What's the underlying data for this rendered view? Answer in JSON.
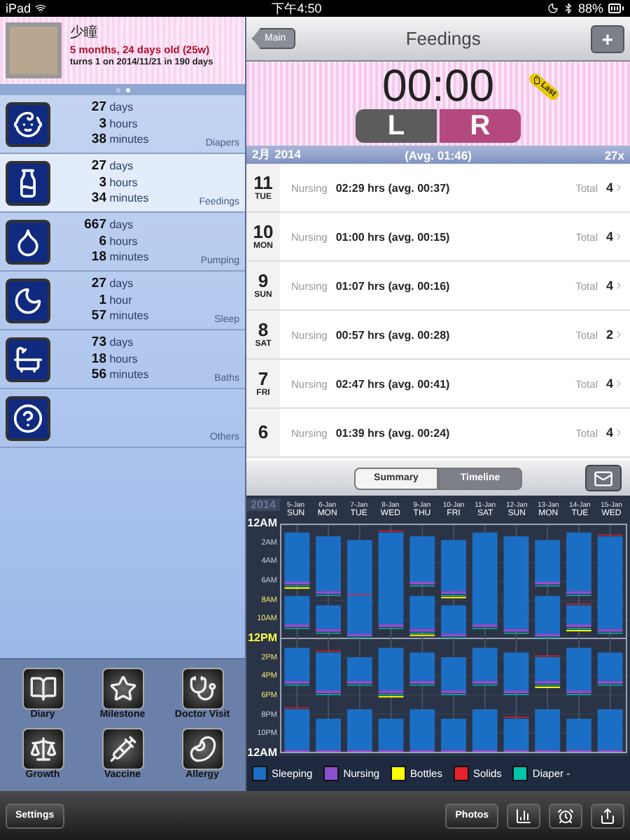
{
  "status_bar": {
    "device": "iPad",
    "time": "下午4:50",
    "battery": "88%"
  },
  "profile": {
    "name": "少瞳",
    "age": "5 months, 24 days old (25w)",
    "birthday": "turns 1 on 2014/11/21 in 190 days"
  },
  "page_dots": [
    {
      "selected": false
    },
    {
      "selected": true
    }
  ],
  "categories": [
    {
      "kind": "diapers",
      "lines": [
        "**27** days",
        "**3** hours",
        "**38** minutes"
      ],
      "label": "Diapers",
      "selected": false
    },
    {
      "kind": "feedings",
      "lines": [
        "**27** days",
        "**3** hours",
        "**34** minutes"
      ],
      "label": "Feedings",
      "selected": true
    },
    {
      "kind": "pumping",
      "lines": [
        "**667** days",
        "**6** hours",
        "**18** minutes"
      ],
      "label": "Pumping",
      "selected": false
    },
    {
      "kind": "sleep",
      "lines": [
        "**27** days",
        "**1** hour",
        "**57** minutes"
      ],
      "label": "Sleep",
      "selected": false
    },
    {
      "kind": "baths",
      "lines": [
        "**73** days",
        "**18** hours",
        "**56** minutes"
      ],
      "label": "Baths",
      "selected": false
    },
    {
      "kind": "others",
      "label": "Others",
      "selected": false
    }
  ],
  "shortcuts": [
    {
      "kind": "diary",
      "label": "Diary"
    },
    {
      "kind": "milestone",
      "label": "Milestone"
    },
    {
      "kind": "doctor",
      "label": "Doctor Visit"
    },
    {
      "kind": "growth",
      "label": "Growth"
    },
    {
      "kind": "vaccine",
      "label": "Vaccine"
    },
    {
      "kind": "allergy",
      "label": "Allergy"
    }
  ],
  "nav": {
    "back": "Main",
    "title": "Feedings",
    "add": "+"
  },
  "timer": {
    "time": "00:00",
    "sides": [
      {
        "label": "L",
        "selected": false
      },
      {
        "label": "R",
        "selected": true
      }
    ],
    "last_tag": "Last"
  },
  "month_bar": {
    "month": "2月 2014",
    "average": "(Avg. 01:46)",
    "count": "27x"
  },
  "days": [
    {
      "day": "11",
      "weekday": "TUE",
      "type": "Nursing",
      "summary": "02:29 hrs (avg. 00:37)",
      "total_label": "Total",
      "total": "4"
    },
    {
      "day": "10",
      "weekday": "MON",
      "type": "Nursing",
      "summary": "01:00 hrs (avg. 00:15)",
      "total_label": "Total",
      "total": "4"
    },
    {
      "day": "9",
      "weekday": "SUN",
      "type": "Nursing",
      "summary": "01:07 hrs (avg. 00:16)",
      "total_label": "Total",
      "total": "4"
    },
    {
      "day": "8",
      "weekday": "SAT",
      "type": "Nursing",
      "summary": "00:57 hrs (avg. 00:28)",
      "total_label": "Total",
      "total": "2"
    },
    {
      "day": "7",
      "weekday": "FRI",
      "type": "Nursing",
      "summary": "02:47 hrs (avg. 00:41)",
      "total_label": "Total",
      "total": "4"
    },
    {
      "day": "6",
      "type": "Nursing",
      "summary": "01:39 hrs (avg. 00:24)",
      "total_label": "Total",
      "total": "4"
    }
  ],
  "view_tabs": [
    {
      "label": "Summary",
      "selected": false
    },
    {
      "label": "Timeline",
      "selected": true
    }
  ],
  "timeline": {
    "year": "2014",
    "columns": [
      {
        "date": "5-Jan",
        "weekday": "SUN"
      },
      {
        "date": "6-Jan",
        "weekday": "MON"
      },
      {
        "date": "7-Jan",
        "weekday": "TUE"
      },
      {
        "date": "8-Jan",
        "weekday": "WED"
      },
      {
        "date": "9-Jan",
        "weekday": "THU"
      },
      {
        "date": "10-Jan",
        "weekday": "FRI"
      },
      {
        "date": "11-Jan",
        "weekday": "SAT"
      },
      {
        "date": "12-Jan",
        "weekday": "SUN"
      },
      {
        "date": "13-Jan",
        "weekday": "MON"
      },
      {
        "date": "14-Jan",
        "weekday": "TUE"
      },
      {
        "date": "15-Jan",
        "weekday": "WED"
      }
    ],
    "hours": [
      {
        "label": "12AM",
        "kind": "midnight"
      },
      {
        "label": "2AM",
        "kind": "night"
      },
      {
        "label": "4AM",
        "kind": "night"
      },
      {
        "label": "6AM",
        "kind": "night"
      },
      {
        "label": "8AM",
        "kind": "day"
      },
      {
        "label": "10AM",
        "kind": "day"
      },
      {
        "label": "12PM",
        "kind": "noon"
      },
      {
        "label": "2PM",
        "kind": "day"
      },
      {
        "label": "4PM",
        "kind": "day"
      },
      {
        "label": "6PM",
        "kind": "day"
      },
      {
        "label": "8PM",
        "kind": "night"
      },
      {
        "label": "10PM",
        "kind": "night"
      },
      {
        "label": "12AM",
        "kind": "midnight"
      }
    ]
  },
  "legend": [
    {
      "label": "Sleeping",
      "color": "#1a6fc4"
    },
    {
      "label": "Nursing",
      "color": "#8c4fcf"
    },
    {
      "label": "Bottles",
      "color": "#ffff00"
    },
    {
      "label": "Solids",
      "color": "#e8202a"
    },
    {
      "label": "Diaper -",
      "color": "#00c4a8"
    }
  ],
  "toolbar": {
    "settings": "Settings",
    "photos": "Photos"
  }
}
